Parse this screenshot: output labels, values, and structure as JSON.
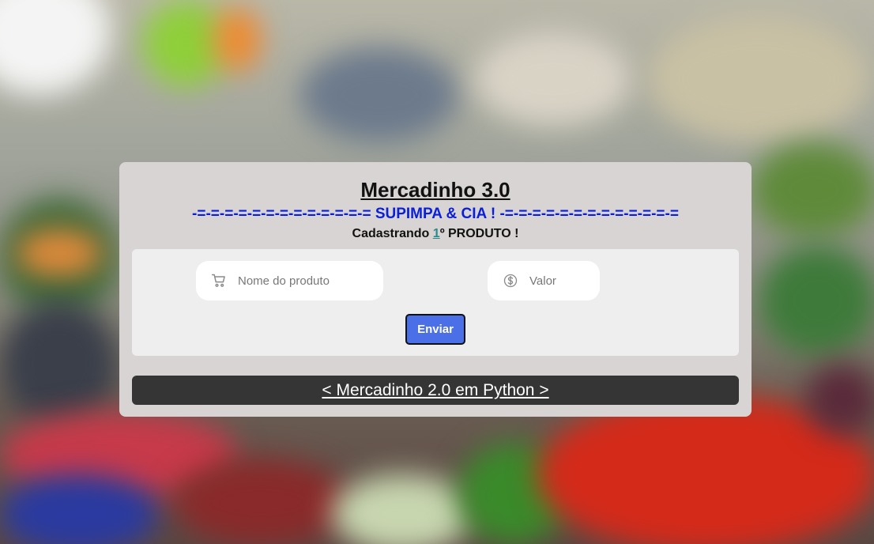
{
  "header": {
    "title": "Mercadinho 3.0",
    "subtitle": "-=-=-=-=-=-=-=-=-=-=-=-=-= SUPIMPA & CIA ! -=-=-=-=-=-=-=-=-=-=-=-=-=",
    "counter_prefix": "Cadastrando ",
    "counter_number": "1",
    "counter_suffix": "º PRODUTO !"
  },
  "form": {
    "product_placeholder": "Nome do produto",
    "product_icon": "cart-icon",
    "value_placeholder": "Valor",
    "value_icon": "dollar-icon",
    "submit_label": "Enviar"
  },
  "footer": {
    "link_label": "< Mercadinho 2.0 em Python >"
  },
  "colors": {
    "card_bg": "#d8d4d3",
    "subtitle": "#0a1fd9",
    "button_bg": "#4b6fe6",
    "footer_bg": "#353535"
  }
}
